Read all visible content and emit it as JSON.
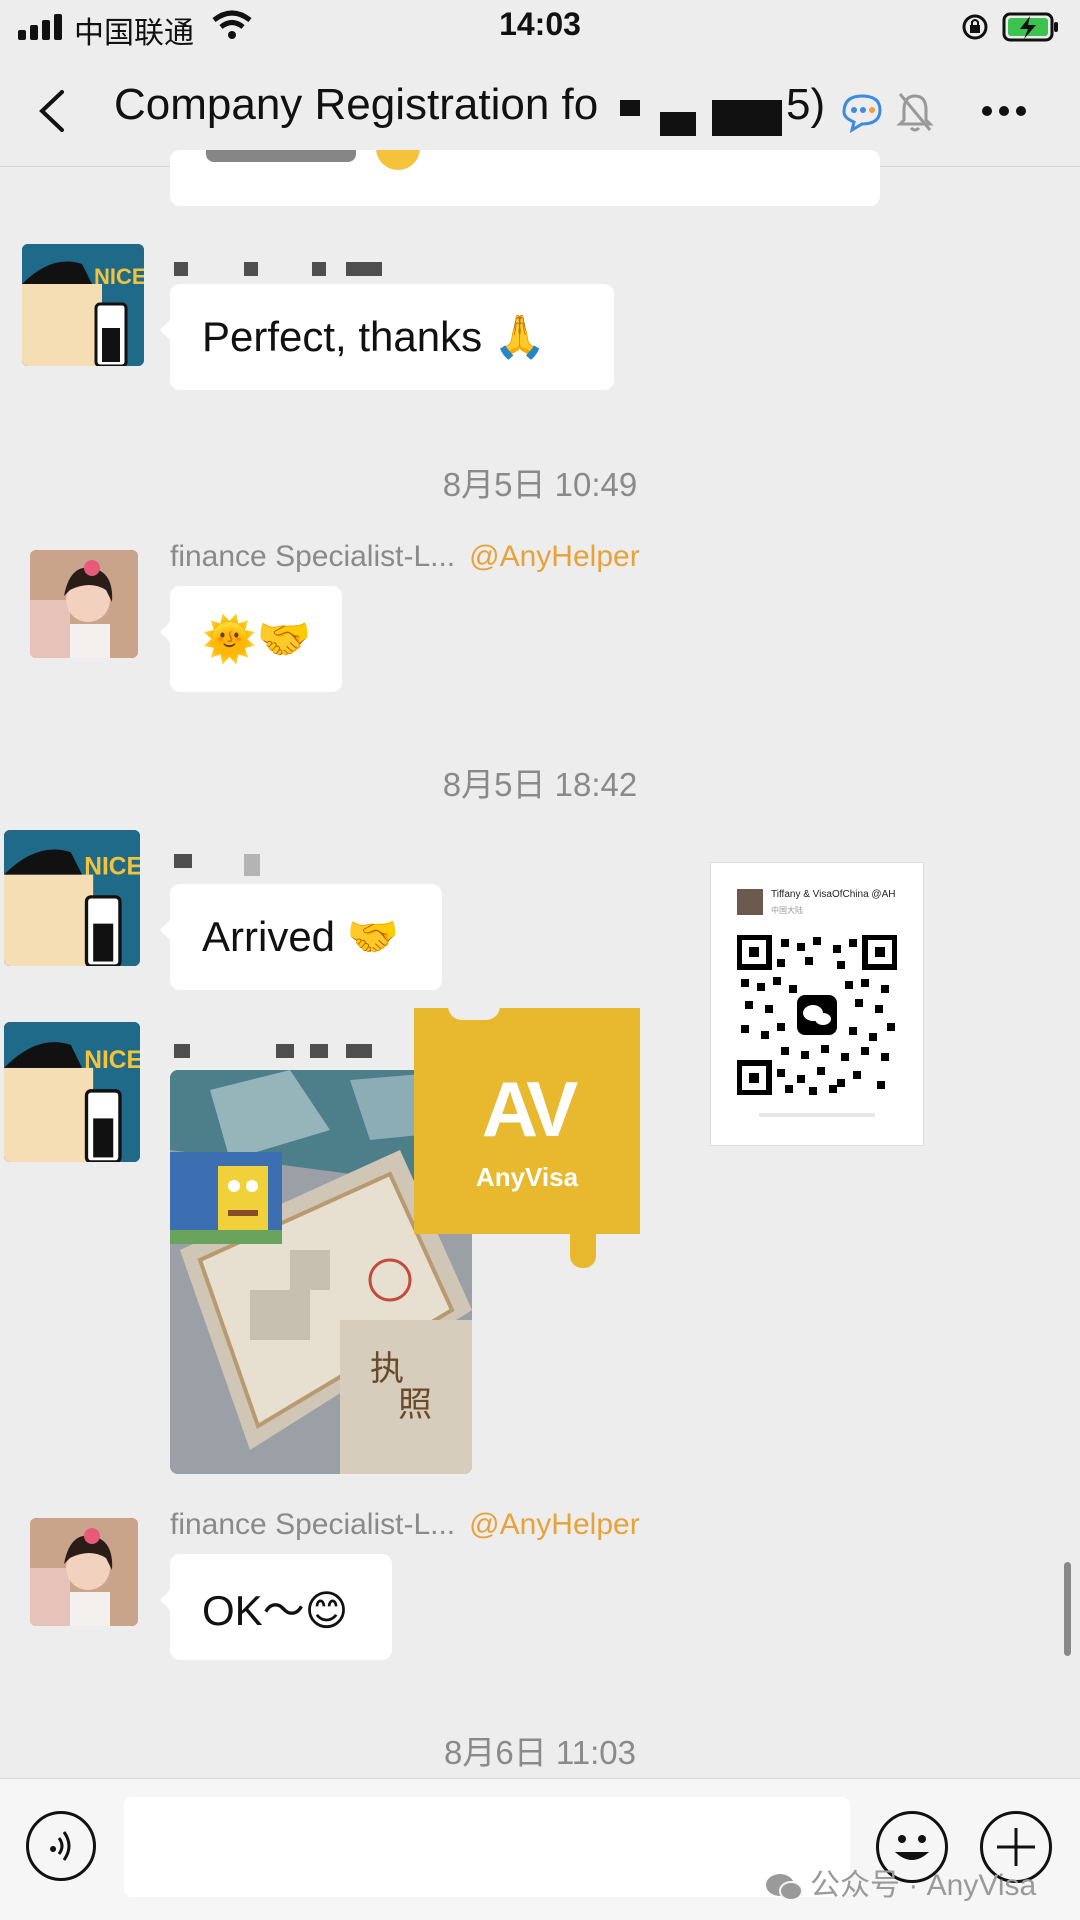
{
  "status_bar": {
    "carrier": "中国联通",
    "time": "14:03"
  },
  "nav": {
    "title": "Company Registration fo",
    "title_tail": "5)"
  },
  "messages": {
    "m1_text": "Perfect, thanks 🙏",
    "ts1": "8月5日 10:49",
    "m2_sender": "finance  Specialist-L...",
    "m2_mention": "@AnyHelper",
    "m2_text": "🌞🤝",
    "ts2": "8月5日 18:42",
    "m3_text": "Arrived 🤝",
    "m4_image_label": "business-license-photo",
    "m5_sender": "finance  Specialist-L...",
    "m5_mention": "@AnyHelper",
    "m5_text": "OK～😊",
    "ts3": "8月6日 11:03"
  },
  "overlay": {
    "logo_letters": "AV",
    "logo_name": "AnyVisa",
    "qr_name": "Tiffany & VisaOfChina @AH",
    "qr_sub": "中国大陆"
  },
  "watermark": "公众号 · AnyVisa",
  "colors": {
    "background": "#ededed",
    "bubble": "#ffffff",
    "mention": "#e8a23a",
    "logo_bg": "#e8b92e"
  }
}
